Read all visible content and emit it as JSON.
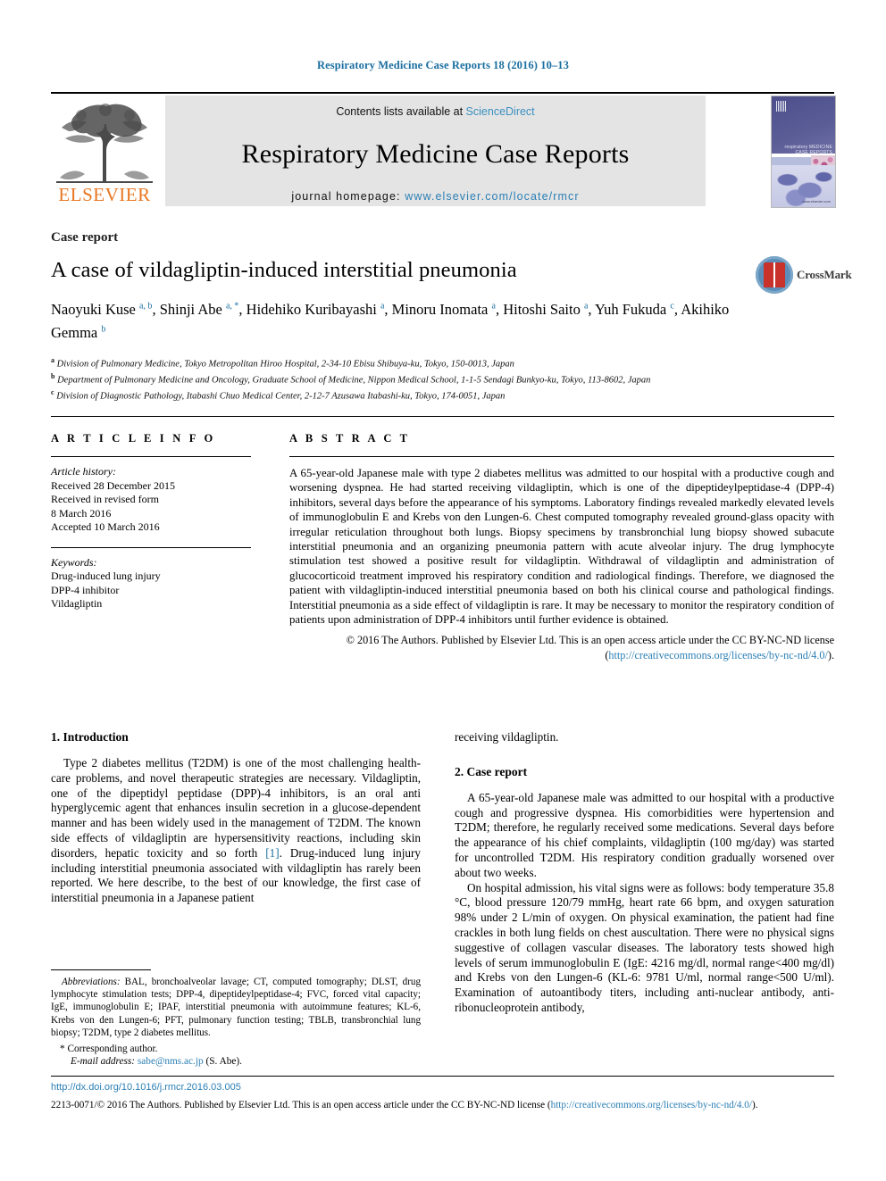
{
  "running_head": "Respiratory Medicine Case Reports 18 (2016) 10–13",
  "banner": {
    "contents_prefix": "Contents lists available at ",
    "contents_link": "ScienceDirect",
    "journal_title": "Respiratory Medicine Case Reports",
    "homepage_prefix": "journal homepage: ",
    "homepage_url": "www.elsevier.com/locate/rmcr",
    "publisher_wordmark": "ELSEVIER",
    "cover_title_line1": "respiratory MEDICINE",
    "cover_title_line2": "CASE REPORTS",
    "cover_caption": "www.elsevier.com"
  },
  "article": {
    "kind": "Case report",
    "title": "A case of vildagliptin-induced interstitial pneumonia",
    "crossmark_label": "CrossMark",
    "authors": [
      {
        "name": "Naoyuki Kuse",
        "marks": "a, b",
        "sep": ", "
      },
      {
        "name": "Shinji Abe",
        "marks": "a, *",
        "sep": ", "
      },
      {
        "name": "Hidehiko Kuribayashi",
        "marks": "a",
        "sep": ", "
      },
      {
        "name": "Minoru Inomata",
        "marks": "a",
        "sep": ", "
      },
      {
        "name": "Hitoshi Saito",
        "marks": "a",
        "sep": ", "
      },
      {
        "name": "Yuh Fukuda",
        "marks": "c",
        "sep": ", "
      },
      {
        "name": "Akihiko Gemma",
        "marks": "b",
        "sep": ""
      }
    ],
    "affiliations": [
      {
        "mark": "a",
        "text": "Division of Pulmonary Medicine, Tokyo Metropolitan Hiroo Hospital, 2-34-10 Ebisu Shibuya-ku, Tokyo, 150-0013, Japan"
      },
      {
        "mark": "b",
        "text": "Department of Pulmonary Medicine and Oncology, Graduate School of Medicine, Nippon Medical School, 1-1-5 Sendagi Bunkyo-ku, Tokyo, 113-8602, Japan"
      },
      {
        "mark": "c",
        "text": "Division of Diagnostic Pathology, Itabashi Chuo Medical Center, 2-12-7 Azusawa Itabashi-ku, Tokyo, 174-0051, Japan"
      }
    ]
  },
  "article_info": {
    "heading": "A R T I C L E   I N F O",
    "history_label": "Article history:",
    "history_lines": [
      "Received 28 December 2015",
      "Received in revised form",
      "8 March 2016",
      "Accepted 10 March 2016"
    ],
    "keywords_label": "Keywords:",
    "keywords": [
      "Drug-induced lung injury",
      "DPP-4 inhibitor",
      "Vildagliptin"
    ]
  },
  "abstract": {
    "heading": "A B S T R A C T",
    "body": "A 65-year-old Japanese male with type 2 diabetes mellitus was admitted to our hospital with a productive cough and worsening dyspnea. He had started receiving vildagliptin, which is one of the dipeptideylpeptidase-4 (DPP-4) inhibitors, several days before the appearance of his symptoms. Laboratory findings revealed markedly elevated levels of immunoglobulin E and Krebs von den Lungen-6. Chest computed tomography revealed ground-glass opacity with irregular reticulation throughout both lungs. Biopsy specimens by transbronchial lung biopsy showed subacute interstitial pneumonia and an organizing pneumonia pattern with acute alveolar injury. The drug lymphocyte stimulation test showed a positive result for vildagliptin. Withdrawal of vildagliptin and administration of glucocorticoid treatment improved his respiratory condition and radiological findings. Therefore, we diagnosed the patient with vildagliptin-induced interstitial pneumonia based on both his clinical course and pathological findings. Interstitial pneumonia as a side effect of vildagliptin is rare. It may be necessary to monitor the respiratory condition of patients upon administration of DPP-4 inhibitors until further evidence is obtained.",
    "copyright_text": "© 2016 The Authors. Published by Elsevier Ltd. This is an open access article under the CC BY-NC-ND license (",
    "copyright_link": "http://creativecommons.org/licenses/by-nc-nd/4.0/",
    "copyright_tail": ")."
  },
  "sections": {
    "intro_heading": "1. Introduction",
    "intro_p1_a": "Type 2 diabetes mellitus (T2DM) is one of the most challenging health-care problems, and novel therapeutic strategies are necessary. Vildagliptin, one of the dipeptidyl peptidase (DPP)-4 inhibitors, is an oral anti hyperglycemic agent that enhances insulin secretion in a glucose-dependent manner and has been widely used in the management of T2DM. The known side effects of vildagliptin are hypersensitivity reactions, including skin disorders, hepatic toxicity and so forth ",
    "intro_ref": "[1]",
    "intro_p1_b": ". Drug-induced lung injury including interstitial pneumonia associated with vildagliptin has rarely been reported. We here describe, to the best of our knowledge, the first case of interstitial pneumonia in a Japanese patient",
    "intro_carryover": "receiving vildagliptin.",
    "case_heading": "2. Case report",
    "case_p1": "A 65-year-old Japanese male was admitted to our hospital with a productive cough and progressive dyspnea. His comorbidities were hypertension and T2DM; therefore, he regularly received some medications. Several days before the appearance of his chief complaints, vildagliptin (100 mg/day) was started for uncontrolled T2DM. His respiratory condition gradually worsened over about two weeks.",
    "case_p2": "On hospital admission, his vital signs were as follows: body temperature 35.8 °C, blood pressure 120/79 mmHg, heart rate 66 bpm, and oxygen saturation 98% under 2 L/min of oxygen. On physical examination, the patient had fine crackles in both lung fields on chest auscultation. There were no physical signs suggestive of collagen vascular diseases. The laboratory tests showed high levels of serum immunoglobulin E (IgE: 4216 mg/dl, normal range<400 mg/dl) and Krebs von den Lungen-6 (KL-6: 9781 U/ml, normal range<500 U/ml). Examination of autoantibody titers, including anti-nuclear antibody, anti-ribonucleoprotein antibody,"
  },
  "footnotes": {
    "abbrev_label": "Abbreviations:",
    "abbrev_text": " BAL, bronchoalveolar lavage; CT, computed tomography; DLST, drug lymphocyte stimulation tests; DPP-4, dipeptideylpeptidase-4; FVC, forced vital capacity; IgE, immunoglobulin E; IPAF, interstitial pneumonia with autoimmune features; KL-6, Krebs von den Lungen-6; PFT, pulmonary function testing; TBLB, transbronchial lung biopsy; T2DM, type 2 diabetes mellitus.",
    "corresponding": "* Corresponding author.",
    "email_label": "E-mail address:",
    "email_value": "sabe@nms.ac.jp",
    "email_owner": " (S. Abe)."
  },
  "footer": {
    "doi": "http://dx.doi.org/10.1016/j.rmcr.2016.03.005",
    "copyright_prefix": "2213-0071/© 2016 The Authors. Published by Elsevier Ltd. This is an open access article under the CC BY-NC-ND license (",
    "copyright_link": "http://creativecommons.org/licenses/by-nc-nd/4.0/",
    "copyright_tail": ")."
  },
  "colors": {
    "link_blue": "#2b7fb5",
    "headline_blue": "#1a6ea0",
    "elsevier_orange": "#e87722",
    "banner_gray": "#e4e4e4"
  }
}
